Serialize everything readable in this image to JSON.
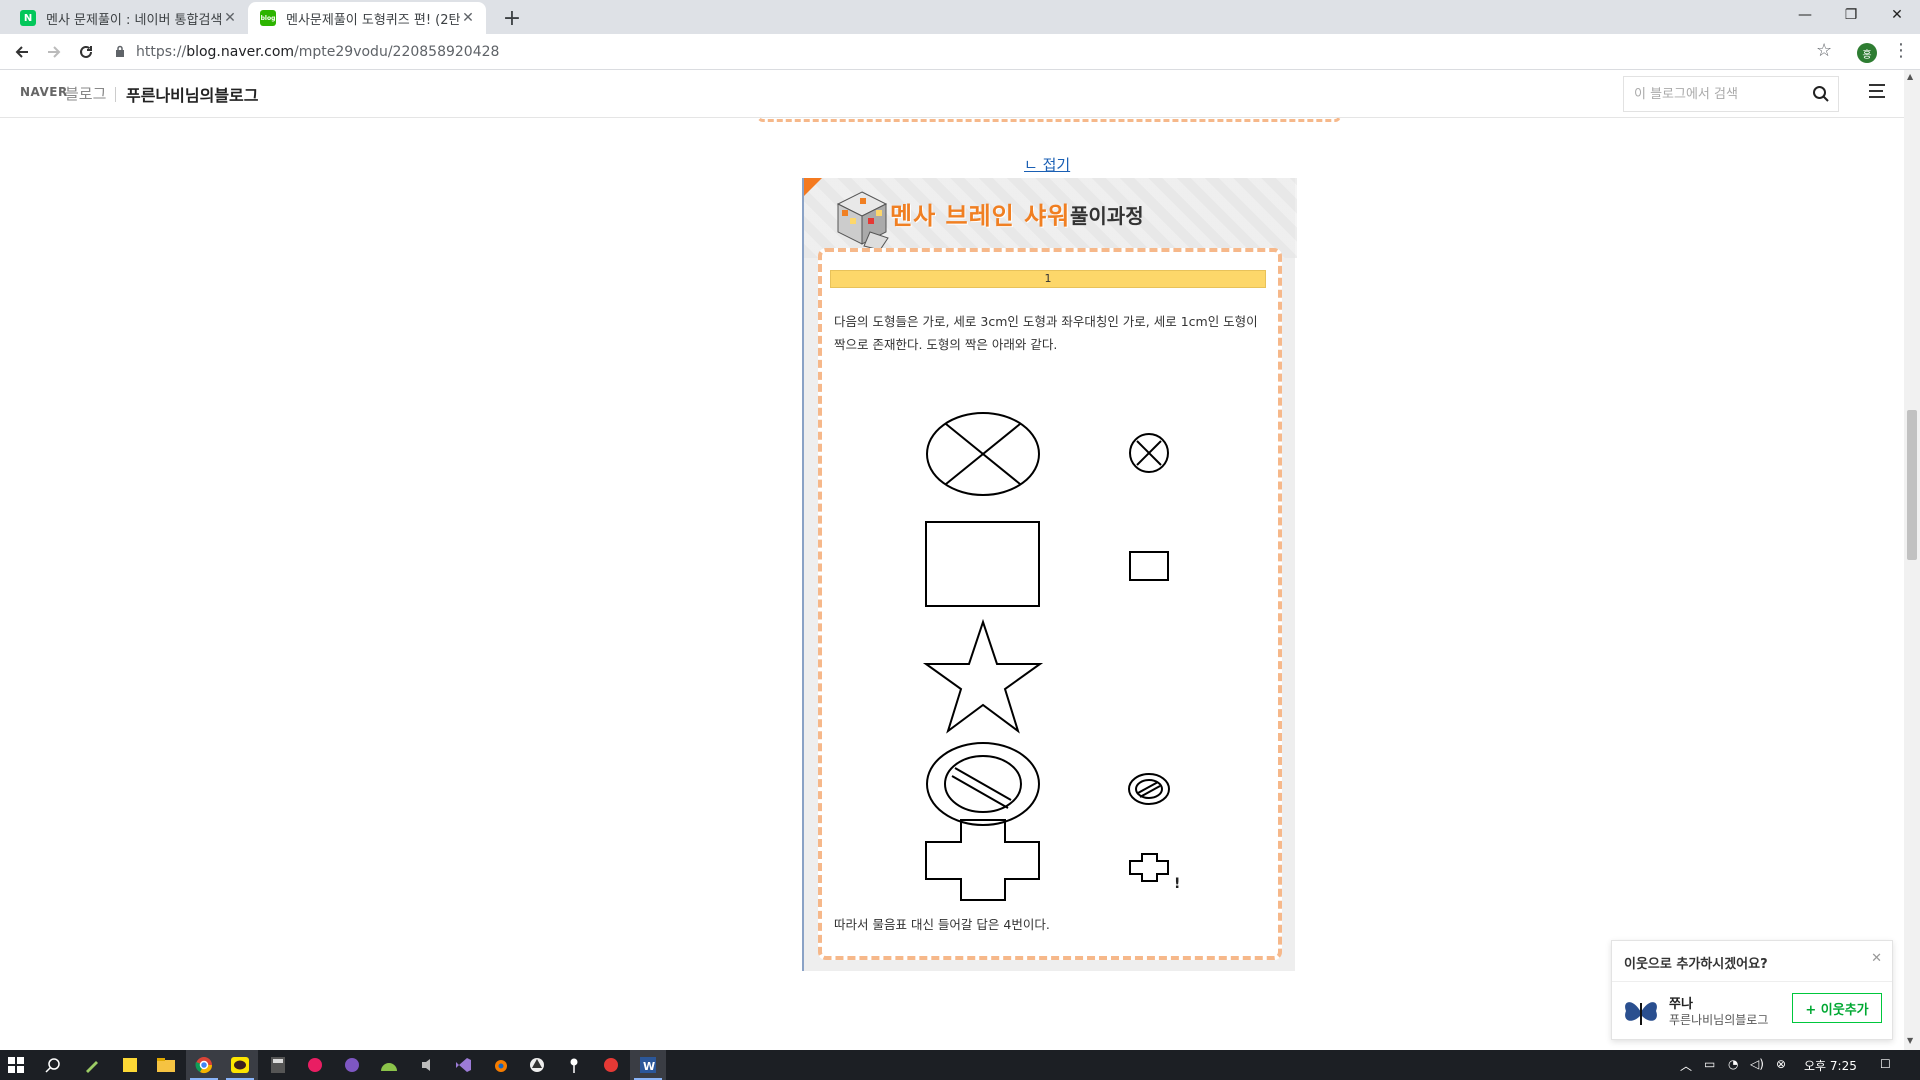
{
  "browser": {
    "tabs": [
      {
        "title": "멘사 문제풀이 : 네이버 통합검색",
        "favicon_letter": "N",
        "favicon_color": "#03c75a"
      },
      {
        "title": "멘사문제풀이 도형퀴즈 편! (2탄",
        "favicon_letter": "blog",
        "favicon_color": "#2db400"
      }
    ],
    "url_scheme": "https://",
    "url_host": "blog.naver.com",
    "url_path": "/mpte29vodu/220858920428",
    "profile_letter": "홍"
  },
  "blog_header": {
    "logo": "NAVER",
    "blog_word": "블로그",
    "blog_name": "푸른나비님의블로그",
    "search_placeholder": "이 블로그에서 검색"
  },
  "post": {
    "fold_link": "ㄴ 접기",
    "card_title": "멘사 브레인 샤워",
    "card_subtitle": "풀이과정",
    "problem_number": "1",
    "explanation": "다음의 도형들은 가로, 세로 3cm인 도형과 좌우대칭인 가로, 세로 1cm인 도형이 짝으로 존재한다. 도형의 짝은 아래와 같다.",
    "marker": "!",
    "conclusion": "따라서 물음표 대신 들어갈 답은 4번이다."
  },
  "neighbor_popup": {
    "question": "이웃으로 추가하시겠어요?",
    "nickname": "쭈나",
    "blog_name": "푸른나비님의블로그",
    "add_label": "+ 이웃추가"
  },
  "taskbar": {
    "time": "오후 7:25"
  },
  "colors": {
    "accent_orange": "#f07f22",
    "naver_green": "#00c73c",
    "yellow_bar": "#fdd76a"
  }
}
